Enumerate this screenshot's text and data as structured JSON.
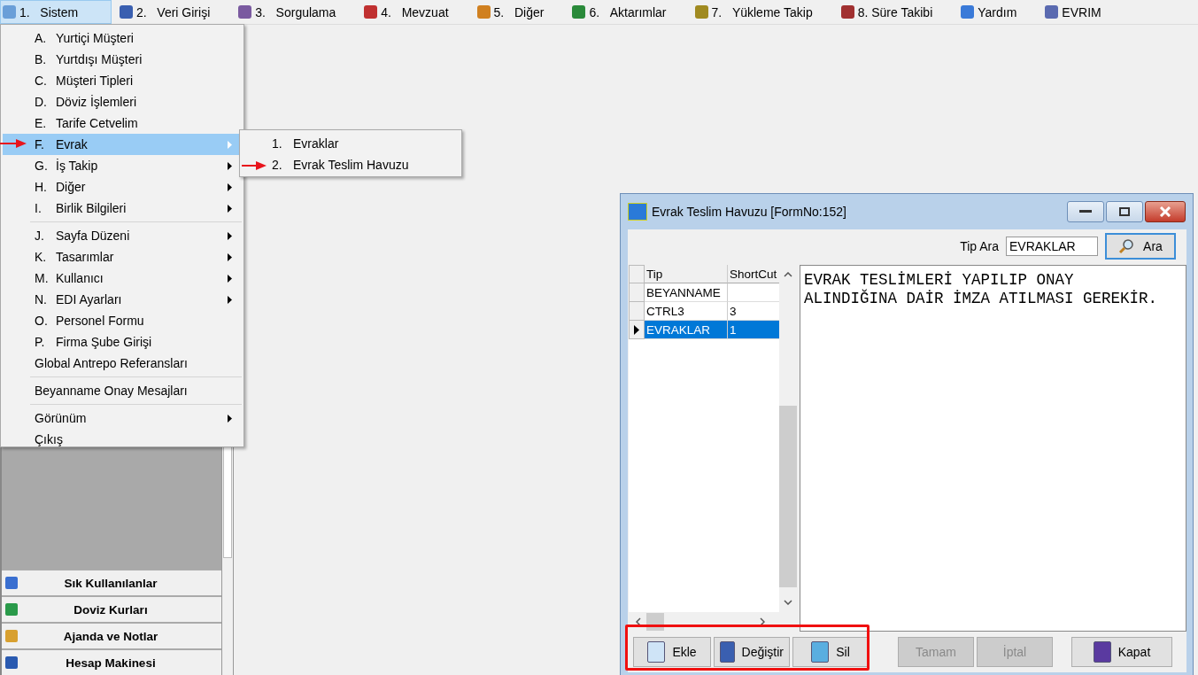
{
  "menubar": [
    {
      "key": "1.",
      "label": "Sistem",
      "selected": true
    },
    {
      "key": "2.",
      "label": "Veri Girişi",
      "selected": false
    },
    {
      "key": "3.",
      "label": "Sorgulama",
      "selected": false
    },
    {
      "key": "4.",
      "label": "Mevzuat",
      "selected": false
    },
    {
      "key": "5.",
      "label": "Diğer",
      "selected": false
    },
    {
      "key": "6.",
      "label": "Aktarımlar",
      "selected": false
    },
    {
      "key": "7.",
      "label": "Yükleme Takip",
      "selected": false
    },
    {
      "label": "8. Süre Takibi",
      "selected": false
    },
    {
      "label": "Yardım",
      "selected": false
    },
    {
      "label": "EVRIM",
      "selected": false
    }
  ],
  "menu": [
    {
      "kind": "item",
      "key": "A.",
      "label": "Yurtiçi Müşteri",
      "submenu": false,
      "selected": false
    },
    {
      "kind": "item",
      "key": "B.",
      "label": "Yurtdışı Müşteri",
      "submenu": false,
      "selected": false
    },
    {
      "kind": "item",
      "key": "C.",
      "label": "Müşteri Tipleri",
      "submenu": false,
      "selected": false
    },
    {
      "kind": "item",
      "key": "D.",
      "label": "Döviz İşlemleri",
      "submenu": false,
      "selected": false
    },
    {
      "kind": "item",
      "key": "E.",
      "label": "Tarife Cetvelim",
      "submenu": false,
      "selected": false
    },
    {
      "kind": "item",
      "key": "F.",
      "label": "Evrak",
      "submenu": true,
      "selected": true
    },
    {
      "kind": "item",
      "key": "G.",
      "label": "İş Takip",
      "submenu": true,
      "selected": false
    },
    {
      "kind": "item",
      "key": "H.",
      "label": "Diğer",
      "submenu": true,
      "selected": false
    },
    {
      "kind": "item",
      "key": "I.",
      "label": "Birlik Bilgileri",
      "submenu": true,
      "selected": false
    },
    {
      "kind": "separator"
    },
    {
      "kind": "item",
      "key": "J.",
      "label": "Sayfa Düzeni",
      "submenu": true,
      "selected": false
    },
    {
      "kind": "item",
      "key": "K.",
      "label": "Tasarımlar",
      "submenu": true,
      "selected": false
    },
    {
      "kind": "item",
      "key": "M.",
      "label": "Kullanıcı",
      "submenu": true,
      "selected": false
    },
    {
      "kind": "item",
      "key": "N.",
      "label": "EDI Ayarları",
      "submenu": true,
      "selected": false
    },
    {
      "kind": "item",
      "key": "O.",
      "label": "Personel Formu",
      "submenu": false,
      "selected": false
    },
    {
      "kind": "item",
      "key": "P.",
      "label": "Firma Şube Girişi",
      "submenu": false,
      "selected": false
    },
    {
      "kind": "item",
      "label": "Global Antrepo Referansları",
      "submenu": false,
      "selected": false
    },
    {
      "kind": "separator"
    },
    {
      "kind": "item",
      "label": "Beyanname Onay Mesajları",
      "submenu": false,
      "selected": false
    },
    {
      "kind": "separator"
    },
    {
      "kind": "item",
      "label": "Görünüm",
      "submenu": true,
      "selected": false
    },
    {
      "kind": "item",
      "label": "Çıkış",
      "submenu": false,
      "selected": false
    }
  ],
  "submenu": [
    {
      "key": "1.",
      "label": "Evraklar"
    },
    {
      "key": "2.",
      "label": "Evrak Teslim Havuzu"
    }
  ],
  "sidebar": {
    "buttons": [
      "Sık Kullanılanlar",
      "Doviz Kurları",
      "Ajanda ve Notlar",
      "Hesap Makinesi"
    ]
  },
  "dialog": {
    "title": "Evrak Teslim Havuzu [FormNo:152]",
    "search": {
      "label": "Tip Ara",
      "value": "EVRAKLAR",
      "button": "Ara"
    },
    "table": {
      "columns": [
        "Tip",
        "ShortCut"
      ],
      "rows": [
        {
          "tip": "BEYANNAME",
          "selected": false
        },
        {
          "tip": "CTRL3",
          "shortcut": "3",
          "selected": false
        },
        {
          "tip": "EVRAKLAR",
          "shortcut": "1",
          "selected": true
        }
      ]
    },
    "memo": {
      "lines": [
        "EVRAK TESLİMLERİ YAPILIP ONAY",
        "ALINDIĞINA DAİR İMZA ATILMASI GEREKİR."
      ]
    },
    "buttons": [
      {
        "label": "Ekle",
        "disabled": false
      },
      {
        "label": "Değiştir",
        "disabled": false
      },
      {
        "label": "Sil",
        "disabled": false
      },
      {
        "label": "Tamam",
        "disabled": true
      },
      {
        "label": "İptal",
        "disabled": true
      },
      {
        "label": "Kapat",
        "disabled": false
      }
    ]
  }
}
